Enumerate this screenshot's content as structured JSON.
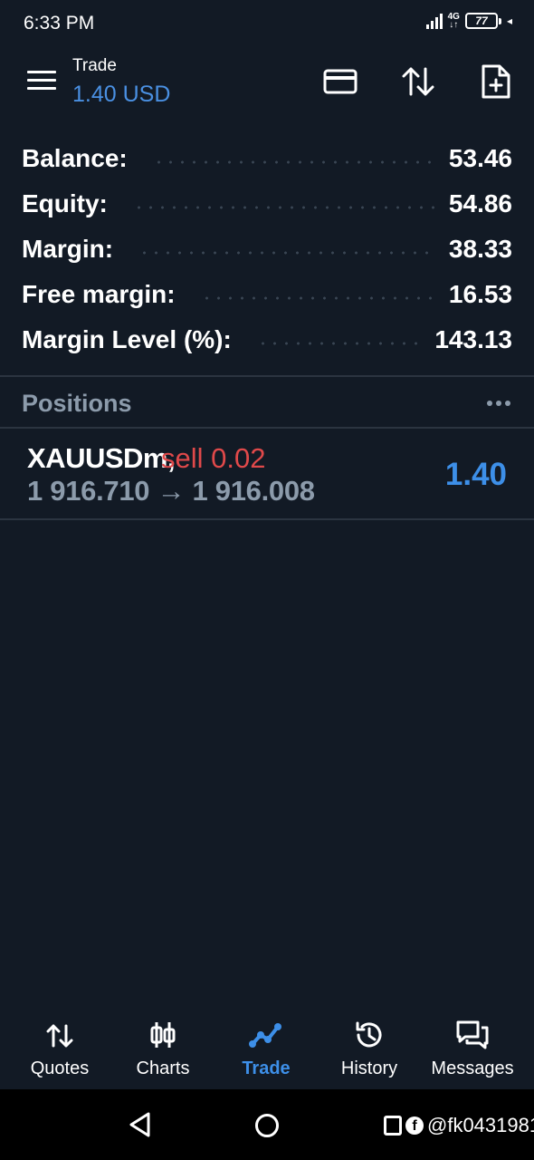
{
  "status_bar": {
    "time": "6:33 PM",
    "network": "4G",
    "battery": "77"
  },
  "header": {
    "title": "Trade",
    "subtitle": "1.40 USD",
    "icons": [
      "menu-icon",
      "card-icon",
      "sort-icon",
      "new-order-icon"
    ]
  },
  "summary": [
    {
      "label": "Balance:",
      "value": "53.46"
    },
    {
      "label": "Equity:",
      "value": "54.86"
    },
    {
      "label": "Margin:",
      "value": "38.33"
    },
    {
      "label": "Free margin:",
      "value": "16.53"
    },
    {
      "label": "Margin Level (%):",
      "value": "143.13"
    }
  ],
  "positions": {
    "title": "Positions",
    "items": [
      {
        "symbol": "XAUUSDm,",
        "side": "sell 0.02",
        "prices": "1 916.710 → 1 916.008",
        "profit": "1.40"
      }
    ]
  },
  "bottom_nav": [
    {
      "label": "Quotes",
      "icon": "quotes-icon"
    },
    {
      "label": "Charts",
      "icon": "charts-icon"
    },
    {
      "label": "Trade",
      "icon": "trade-icon",
      "active": true
    },
    {
      "label": "History",
      "icon": "history-icon"
    },
    {
      "label": "Messages",
      "icon": "messages-icon"
    }
  ],
  "watermark": "@fk0431981",
  "colors": {
    "background": "#121a25",
    "accent": "#3d8fe8",
    "sell": "#e0494a",
    "muted": "#8c9bab",
    "divider": "#2b3440"
  }
}
